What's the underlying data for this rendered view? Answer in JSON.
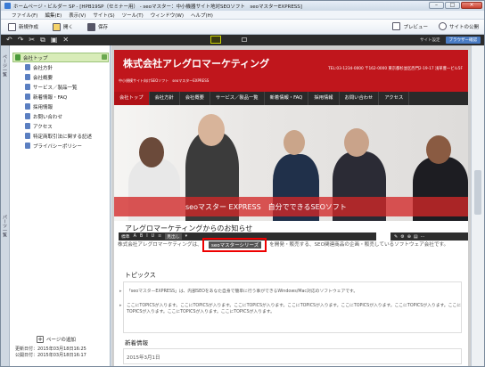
{
  "window": {
    "title": "ホームページ・ビルダー SP - [HPB19SP（セミナー用） - seoマスター：中小機器サイト地対SEOソフト　seoマスターEXPRESS]"
  },
  "menu": [
    "ファイル(F)",
    "編集(E)",
    "表示(V)",
    "サイト(S)",
    "ツール(T)",
    "ウィンドウ(W)",
    "ヘルプ(H)"
  ],
  "toolbar": {
    "buttons": [
      "新規作成",
      "開く",
      "保存"
    ],
    "right_buttons": [
      "プレビュー",
      "サイトの公開"
    ]
  },
  "topbar": {
    "site_settings": "サイト設定",
    "browser_select": "ブラウザー確認"
  },
  "left_tab": "ページ一覧",
  "left_tab2": "パーツ一覧",
  "sidebar": {
    "root": "会社トップ",
    "items": [
      "会社方針",
      "会社概要",
      "サービス／製品一覧",
      "新着情報・FAQ",
      "採用情報",
      "お問い合わせ",
      "アクセス",
      "特定商取引法に関する記述",
      "プライバシーポリシー"
    ],
    "add_page": "ページの追加",
    "updated": "更新日付：2015年03月18日16:25",
    "published": "公開日付：2015年03月18日16:17"
  },
  "site": {
    "company": "株式会社アレグロマーケティング",
    "tel": "TEL:03-1234-0000 〒162-0000 東京都杉並区西門2-19-17 浅草豊一ビル5F",
    "sub": "中小規模サイト向けSEOソフト　seoマスターEXPRESS",
    "nav": [
      "会社トップ",
      "会社方針",
      "会社概要",
      "サービス／製品一覧",
      "新着情報・FAQ",
      "採用情報",
      "お問い合わせ",
      "アクセス"
    ],
    "hero_text": "seoマスター EXPRESS　自分でできるSEOソフト",
    "news_heading": "アレグロマーケティングからのお知らせ",
    "rte_left": [
      "標準",
      "A",
      "B",
      "I",
      "U",
      "≡",
      "見出し",
      "▾"
    ],
    "rte_right": [
      "✎",
      "⚙",
      "⊕",
      "▤",
      "⋯"
    ],
    "body": "株式会社アレグロマーケティングは、　　　　　　　　　　　　　　を開発・販売する、SEO関連商品の企画・販売しているソフトウェア会社です。",
    "highlight": "seoマスターシリーズ",
    "topics_heading": "トピックス",
    "topic1": "「seoマスターEXPRESS」は、内部SEOをあなた自身で簡単に行う事ができるWindows/Mac対応のソフトウェアです。",
    "topic2": "ここにTOPICSが入ります。ここにTOPICSが入ります。ここにTOPICSが入ります。ここにTOPICSが入ります。ここにTOPICSが入ります。ここにTOPICSが入ります。ここにTOPICSが入ります。ここにTOPICSが入ります。ここにTOPICSが入ります。",
    "news2_heading": "新着情報",
    "news_date": "2015年3月1日"
  },
  "colors": {
    "brand_red": "#c0161c",
    "nav_dark": "#2a2a2a",
    "highlight_box": "#e00000",
    "sidebar_selected": "#d8ecb8"
  }
}
